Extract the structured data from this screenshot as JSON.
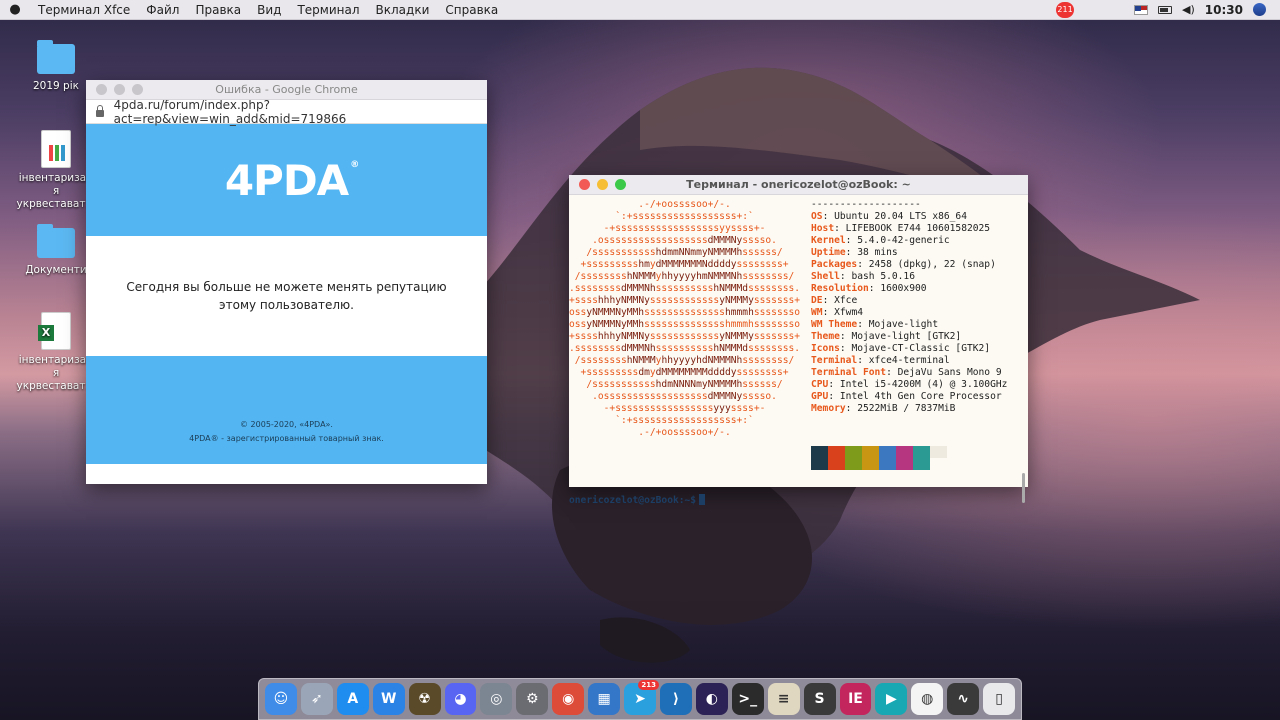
{
  "menubar": {
    "apple_icon": "apple-icon",
    "items": [
      "Терминал Xfce",
      "Файл",
      "Правка",
      "Вид",
      "Терминал",
      "Вкладки",
      "Справка"
    ],
    "notif_badge": "211",
    "clock": "10:30"
  },
  "desktop": {
    "icons": [
      {
        "label": "2019 рік"
      },
      {
        "label": "інвентаризац я укрвестават..."
      },
      {
        "label": "Документи"
      },
      {
        "label": "інвентаризац я укрвестават..."
      }
    ]
  },
  "chrome": {
    "title": "Ошибка - Google Chrome",
    "url": "4pda.ru/forum/index.php?act=rep&view=win_add&mid=719866",
    "logo": "4PDA",
    "logo_reg": "®",
    "message": "Сегодня вы больше не можете менять репутацию этому пользователю.",
    "footer_line1": "© 2005-2020, «4PDA».",
    "footer_line2": "4PDA® - зарегистрированный товарный знак."
  },
  "terminal": {
    "title": "Терминал - onericozelot@ozBook: ~",
    "separator": "-------------------",
    "info": [
      {
        "k": "OS",
        "v": "Ubuntu 20.04 LTS x86_64"
      },
      {
        "k": "Host",
        "v": "LIFEBOOK E744 10601582025"
      },
      {
        "k": "Kernel",
        "v": "5.4.0-42-generic"
      },
      {
        "k": "Uptime",
        "v": "38 mins"
      },
      {
        "k": "Packages",
        "v": "2458 (dpkg), 22 (snap)"
      },
      {
        "k": "Shell",
        "v": "bash 5.0.16"
      },
      {
        "k": "Resolution",
        "v": "1600x900"
      },
      {
        "k": "DE",
        "v": "Xfce"
      },
      {
        "k": "WM",
        "v": "Xfwm4"
      },
      {
        "k": "WM Theme",
        "v": "Mojave-light"
      },
      {
        "k": "Theme",
        "v": "Mojave-light [GTK2]"
      },
      {
        "k": "Icons",
        "v": "Mojave-CT-Classic [GTK2]"
      },
      {
        "k": "Terminal",
        "v": "xfce4-terminal"
      },
      {
        "k": "Terminal Font",
        "v": "DejaVu Sans Mono 9"
      },
      {
        "k": "CPU",
        "v": "Intel i5-4200M (4) @ 3.100GHz"
      },
      {
        "k": "GPU",
        "v": "Intel 4th Gen Core Processor"
      },
      {
        "k": "Memory",
        "v": "2522MiB / 7837MiB"
      }
    ],
    "palette": [
      "#1d3a4a",
      "#d9401c",
      "#7e9b1c",
      "#c99614",
      "#3b78c0",
      "#b6377f",
      "#2a9a92",
      "#eeeae0",
      "#1d3a4a",
      "#d9401c",
      "#7e9b1c",
      "#c99614",
      "#3b78c0",
      "#b6377f",
      "#2a9a92",
      "#fcfaf3"
    ],
    "prompt": "onericozelot@ozBook:~$"
  },
  "dock": {
    "apps": [
      {
        "name": "finder-icon",
        "color": "#3f8be8",
        "glyph": "☺"
      },
      {
        "name": "launchpad-icon",
        "color": "#9aa6b8",
        "glyph": "➶"
      },
      {
        "name": "appstore-icon",
        "color": "#1f8cf0",
        "glyph": "A"
      },
      {
        "name": "wps-writer-icon",
        "color": "#2c83e6",
        "glyph": "W"
      },
      {
        "name": "radiation-icon",
        "color": "#5a4a2a",
        "glyph": "☢"
      },
      {
        "name": "discord-icon",
        "color": "#5865f2",
        "glyph": "◕"
      },
      {
        "name": "disk-icon",
        "color": "#7c8592",
        "glyph": "◎"
      },
      {
        "name": "settings-icon",
        "color": "#6b6b72",
        "glyph": "⚙"
      },
      {
        "name": "chrome-icon",
        "color": "#dd4b39",
        "glyph": "◉"
      },
      {
        "name": "workspace-icon",
        "color": "#3476c8",
        "glyph": "▦"
      },
      {
        "name": "telegram-icon",
        "color": "#2ba0de",
        "glyph": "➤",
        "badge": "213"
      },
      {
        "name": "vscode-icon",
        "color": "#1f6fb8",
        "glyph": "⟩"
      },
      {
        "name": "eclipse-icon",
        "color": "#2c2255",
        "glyph": "◐"
      },
      {
        "name": "terminal-icon",
        "color": "#2b2b2b",
        "glyph": ">_"
      },
      {
        "name": "notes-icon",
        "color": "#e0d7c0",
        "glyph": "≡"
      },
      {
        "name": "sublime-icon",
        "color": "#3a3a3a",
        "glyph": "S"
      },
      {
        "name": "intellij-icon",
        "color": "#c3255d",
        "glyph": "IE"
      },
      {
        "name": "play-icon",
        "color": "#18a8b4",
        "glyph": "▶"
      },
      {
        "name": "github-icon",
        "color": "#f4f4f4",
        "glyph": "◍"
      },
      {
        "name": "monitor-icon",
        "color": "#3a3a3a",
        "glyph": "∿"
      },
      {
        "name": "trash-icon",
        "color": "#e9e9ec",
        "glyph": "▯"
      }
    ]
  }
}
